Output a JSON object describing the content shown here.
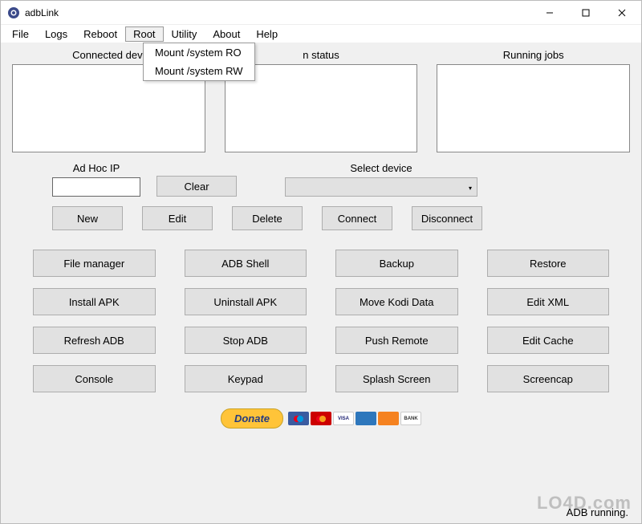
{
  "window": {
    "title": "adbLink"
  },
  "menubar": {
    "items": [
      "File",
      "Logs",
      "Reboot",
      "Root",
      "Utility",
      "About",
      "Help"
    ],
    "active_index": 3,
    "dropdown": {
      "items": [
        "Mount /system RO",
        "Mount /system RW"
      ]
    }
  },
  "panels": {
    "connected": "Connected devi",
    "status": "n status",
    "jobs": "Running jobs"
  },
  "adhoc": {
    "label": "Ad Hoc IP",
    "value": ""
  },
  "clear_btn": "Clear",
  "select": {
    "label": "Select device",
    "value": ""
  },
  "device_buttons": [
    "New",
    "Edit",
    "Delete",
    "Connect",
    "Disconnect"
  ],
  "grid_buttons": [
    "File manager",
    "ADB Shell",
    "Backup",
    "Restore",
    "Install APK",
    "Uninstall APK",
    "Move Kodi Data",
    "Edit XML",
    "Refresh ADB",
    "Stop ADB",
    "Push Remote",
    "Edit Cache",
    "Console",
    "Keypad",
    "Splash Screen",
    "Screencap"
  ],
  "donate": {
    "label": "Donate"
  },
  "cards": [
    {
      "name": "maestro",
      "bg": "#3a5ba0",
      "text": ""
    },
    {
      "name": "mastercard",
      "bg": "#cc0000",
      "text": ""
    },
    {
      "name": "visa",
      "bg": "#ffffff",
      "text": "VISA",
      "fg": "#1a1f71"
    },
    {
      "name": "amex",
      "bg": "#2e77bc",
      "text": ""
    },
    {
      "name": "discover",
      "bg": "#f58220",
      "text": ""
    },
    {
      "name": "bank",
      "bg": "#ffffff",
      "text": "BANK",
      "fg": "#333"
    }
  ],
  "status": "ADB running.",
  "watermark": "LO4D.com"
}
